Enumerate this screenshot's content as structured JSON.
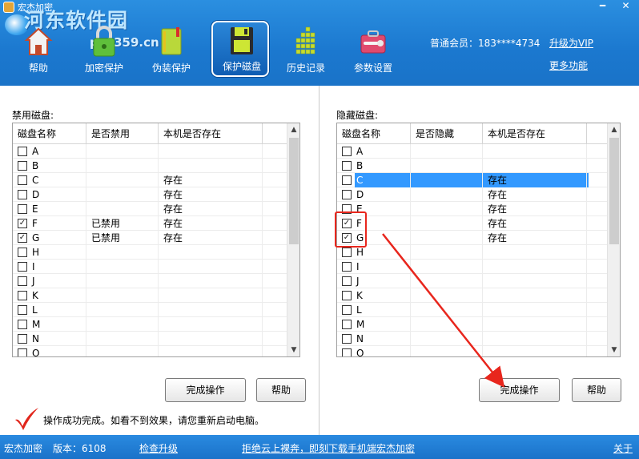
{
  "window": {
    "title": "宏杰加密",
    "minimize_glyph": "━",
    "close_glyph": "✕"
  },
  "watermark": {
    "text": "河东软件园",
    "url": "pc0359.cn"
  },
  "toolbar": {
    "items": [
      {
        "label": "帮助",
        "icon": "house-icon"
      },
      {
        "label": "加密保护",
        "icon": "lock-icon"
      },
      {
        "label": "伪装保护",
        "icon": "notebook-icon"
      },
      {
        "label": "保护磁盘",
        "icon": "floppy-disk-icon"
      },
      {
        "label": "历史记录",
        "icon": "grid-chart-icon"
      },
      {
        "label": "参数设置",
        "icon": "toolbox-icon"
      }
    ],
    "active_index": 3
  },
  "account": {
    "member_label": "普通会员：183****4734",
    "upgrade_link": "升级为VIP",
    "more_link": "更多功能"
  },
  "left_panel": {
    "title": "禁用磁盘:",
    "columns": [
      "磁盘名称",
      "是否禁用",
      "本机是否存在"
    ],
    "rows": [
      {
        "drive": "A",
        "checked": false,
        "status": "",
        "exists": ""
      },
      {
        "drive": "B",
        "checked": false,
        "status": "",
        "exists": ""
      },
      {
        "drive": "C",
        "checked": false,
        "status": "",
        "exists": "存在"
      },
      {
        "drive": "D",
        "checked": false,
        "status": "",
        "exists": "存在"
      },
      {
        "drive": "E",
        "checked": false,
        "status": "",
        "exists": "存在"
      },
      {
        "drive": "F",
        "checked": true,
        "status": "已禁用",
        "exists": "存在"
      },
      {
        "drive": "G",
        "checked": true,
        "status": "已禁用",
        "exists": "存在"
      },
      {
        "drive": "H",
        "checked": false,
        "status": "",
        "exists": ""
      },
      {
        "drive": "I",
        "checked": false,
        "status": "",
        "exists": ""
      },
      {
        "drive": "J",
        "checked": false,
        "status": "",
        "exists": ""
      },
      {
        "drive": "K",
        "checked": false,
        "status": "",
        "exists": ""
      },
      {
        "drive": "L",
        "checked": false,
        "status": "",
        "exists": ""
      },
      {
        "drive": "M",
        "checked": false,
        "status": "",
        "exists": ""
      },
      {
        "drive": "N",
        "checked": false,
        "status": "",
        "exists": ""
      },
      {
        "drive": "O",
        "checked": false,
        "status": "",
        "exists": ""
      }
    ],
    "finish_button": "完成操作",
    "help_button": "帮助"
  },
  "right_panel": {
    "title": "隐藏磁盘:",
    "columns": [
      "磁盘名称",
      "是否隐藏",
      "本机是否存在"
    ],
    "selected_index": 2,
    "rows": [
      {
        "drive": "A",
        "checked": false,
        "status": "",
        "exists": ""
      },
      {
        "drive": "B",
        "checked": false,
        "status": "",
        "exists": ""
      },
      {
        "drive": "C",
        "checked": false,
        "status": "",
        "exists": "存在"
      },
      {
        "drive": "D",
        "checked": false,
        "status": "",
        "exists": "存在"
      },
      {
        "drive": "E",
        "checked": false,
        "status": "",
        "exists": "存在"
      },
      {
        "drive": "F",
        "checked": true,
        "status": "",
        "exists": "存在"
      },
      {
        "drive": "G",
        "checked": true,
        "status": "",
        "exists": "存在"
      },
      {
        "drive": "H",
        "checked": false,
        "status": "",
        "exists": ""
      },
      {
        "drive": "I",
        "checked": false,
        "status": "",
        "exists": ""
      },
      {
        "drive": "J",
        "checked": false,
        "status": "",
        "exists": ""
      },
      {
        "drive": "K",
        "checked": false,
        "status": "",
        "exists": ""
      },
      {
        "drive": "L",
        "checked": false,
        "status": "",
        "exists": ""
      },
      {
        "drive": "M",
        "checked": false,
        "status": "",
        "exists": ""
      },
      {
        "drive": "N",
        "checked": false,
        "status": "",
        "exists": ""
      },
      {
        "drive": "O",
        "checked": false,
        "status": "",
        "exists": ""
      }
    ],
    "finish_button": "完成操作",
    "help_button": "帮助"
  },
  "message": {
    "text": "操作成功完成。如看不到效果，请您重新启动电脑。"
  },
  "statusbar": {
    "app_name": "宏杰加密",
    "version": "版本：6108",
    "check_update": "检查升级",
    "promo": "拒绝云上裸奔，即刻下载手机端宏杰加密",
    "close": "关于"
  },
  "colors": {
    "header_blue": "#1b78cf",
    "selection_blue": "#3399ff",
    "annotation_red": "#e8261d"
  }
}
